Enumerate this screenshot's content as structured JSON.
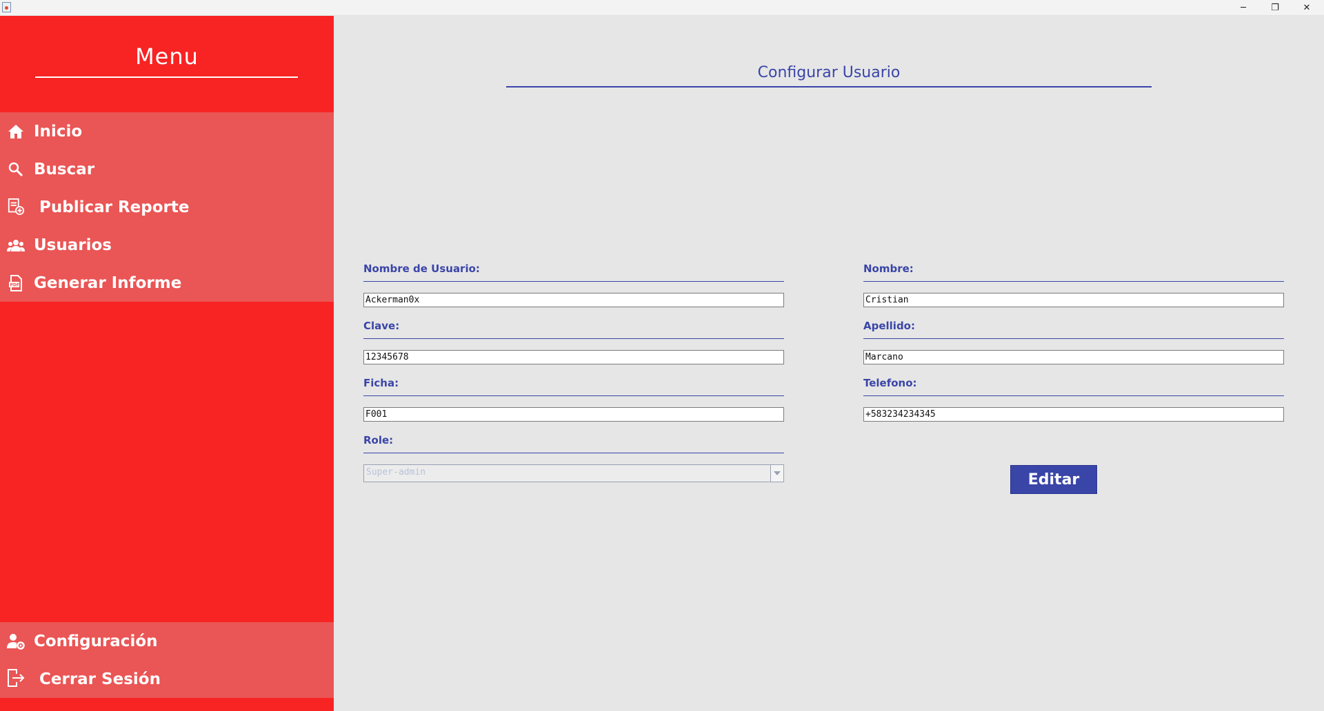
{
  "window": {
    "minimize_glyph": "─",
    "maximize_glyph": "❐",
    "close_glyph": "✕"
  },
  "sidebar": {
    "title": "Menu",
    "items": [
      {
        "label": "Inicio",
        "icon": "home-icon"
      },
      {
        "label": "Buscar",
        "icon": "search-icon"
      },
      {
        "label": "Publicar Reporte",
        "icon": "report-add-icon"
      },
      {
        "label": "Usuarios",
        "icon": "users-icon"
      },
      {
        "label": "Generar Informe",
        "icon": "pdf-icon"
      }
    ],
    "bottom_items": [
      {
        "label": "Configuración",
        "icon": "user-settings-icon"
      },
      {
        "label": "Cerrar Sesión",
        "icon": "logout-icon"
      }
    ]
  },
  "main": {
    "title": "Configurar Usuario",
    "form": {
      "username": {
        "label": "Nombre de Usuario:",
        "value": "Ackerman0x"
      },
      "password": {
        "label": "Clave:",
        "value": "12345678"
      },
      "ficha": {
        "label": "Ficha:",
        "value": "F001"
      },
      "role": {
        "label": "Role:",
        "value": "Super-admin"
      },
      "first_name": {
        "label": "Nombre:",
        "value": "Cristian"
      },
      "last_name": {
        "label": "Apellido:",
        "value": "Marcano"
      },
      "phone": {
        "label": "Telefono:",
        "value": "+583234234345"
      }
    },
    "edit_button": "Editar"
  },
  "colors": {
    "sidebar_bg": "#f82323",
    "nav_group_bg": "#ea5555",
    "main_bg": "#e6e6e6",
    "accent": "#3a45a8"
  }
}
